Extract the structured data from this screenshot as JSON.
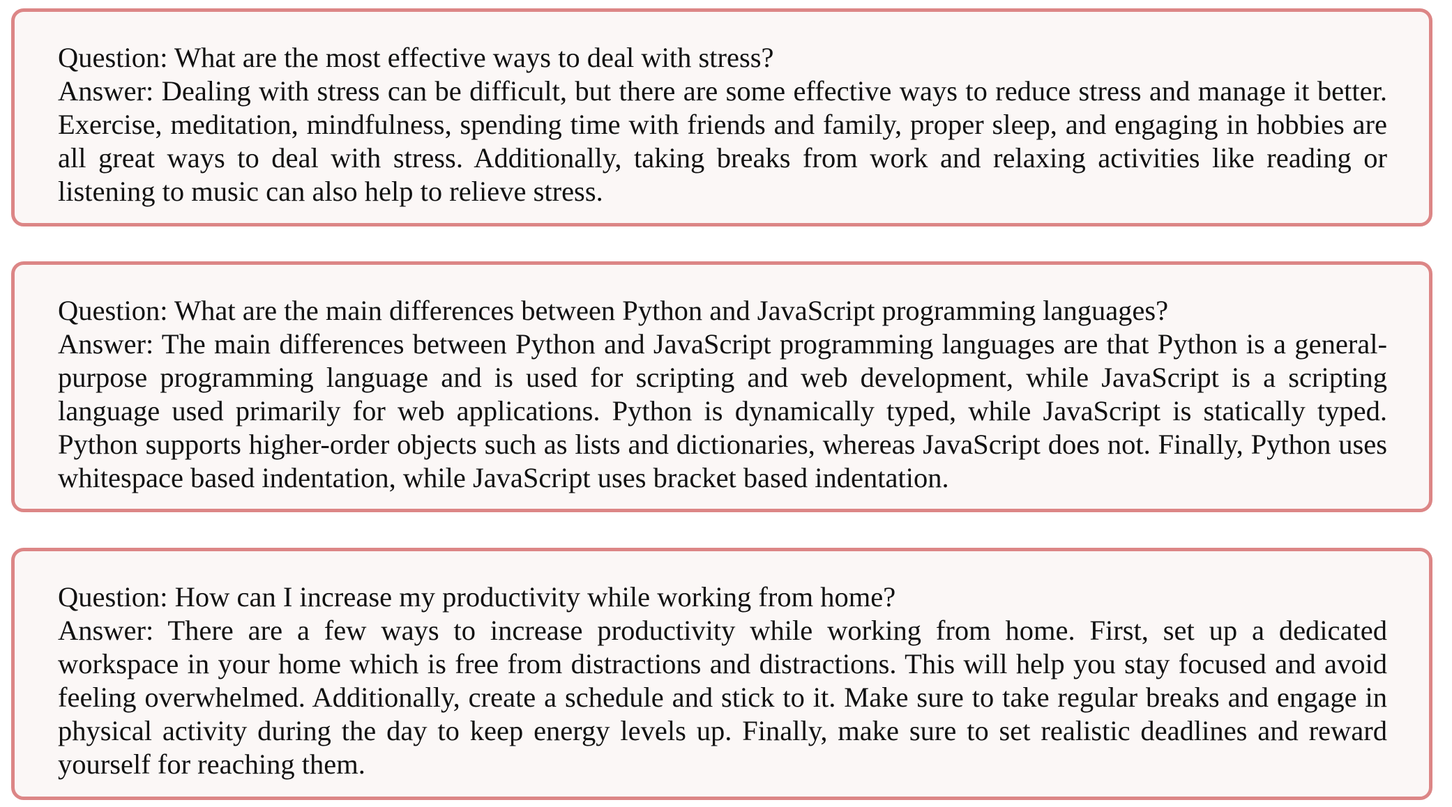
{
  "qa_items": [
    {
      "question": "Question: What are the most effective ways to deal with stress?",
      "answer": "Answer: Dealing with stress can be difficult, but there are some effective ways to reduce stress and manage it better. Exercise, meditation, mindfulness, spending time with friends and family, proper sleep, and engaging in hobbies are all great ways to deal with stress. Additionally, taking breaks from work and relaxing activities like reading or listening to music can also help to relieve stress."
    },
    {
      "question": "Question: What are the main differences between Python and JavaScript programming languages?",
      "answer": "Answer: The main differences between Python and JavaScript programming languages are that Python is a general-purpose programming language and is used for scripting and web development, while JavaScript is a scripting language used primarily for web applications. Python is dynamically typed, while JavaScript is statically typed. Python supports higher-order objects such as lists and dictionaries, whereas JavaScript does not. Finally, Python uses whitespace based indentation, while JavaScript uses bracket based indentation."
    },
    {
      "question": "Question: How can I increase my productivity while working from home?",
      "answer": "Answer: There are a few ways to increase productivity while working from home. First, set up a dedicated workspace in your home which is free from distractions and distractions. This will help you stay focused and avoid feeling overwhelmed. Additionally, create a schedule and stick to it. Make sure to take regular breaks and engage in physical activity during the day to keep energy levels up. Finally, make sure to set realistic deadlines and reward yourself for reaching them."
    }
  ],
  "colors": {
    "box_border": "#dc8686",
    "box_background": "#fbf7f6",
    "text": "#111111"
  }
}
